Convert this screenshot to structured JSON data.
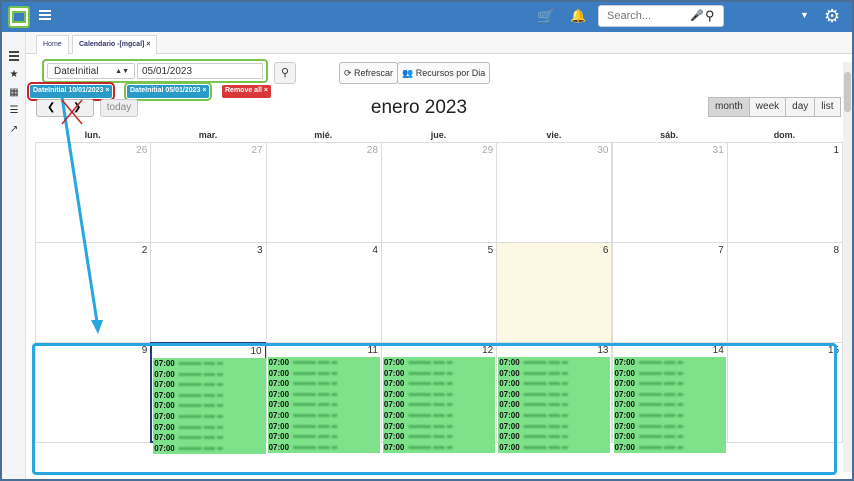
{
  "header": {
    "search_placeholder": "Search..."
  },
  "tabs": [
    {
      "label": "Home"
    },
    {
      "label": "Calendario -[mgcal]",
      "close": "×"
    }
  ],
  "filter": {
    "field": "DateInitial",
    "value": "05/01/2023",
    "refresh_label": "Refrescar",
    "resources_label": "Recursos por Dia"
  },
  "chips": [
    {
      "label": "DateInitial 10/01/2023 ×"
    },
    {
      "label": "DateInitial 05/01/2023 ×"
    },
    {
      "label": "Remove all ×"
    }
  ],
  "calendar": {
    "title": "enero 2023",
    "today_label": "today",
    "views": [
      "month",
      "week",
      "day",
      "list"
    ],
    "active_view": "month",
    "weekdays": [
      "lun.",
      "mar.",
      "mié.",
      "jue.",
      "vie.",
      "sáb.",
      "dom."
    ],
    "weeks": [
      [
        "26",
        "27",
        "28",
        "29",
        "30",
        "31",
        "1"
      ],
      [
        "2",
        "3",
        "4",
        "5",
        "6",
        "7",
        "8"
      ],
      [
        "9",
        "10",
        "11",
        "12",
        "13",
        "14",
        "15"
      ]
    ],
    "today_day": "6",
    "event_time": "07:00"
  },
  "colors": {
    "topbar": "#3b7dc0",
    "event": "#7ee28a",
    "highlight": "#27a6e0",
    "chip": "#2a9bc9",
    "remove": "#d9383b"
  }
}
